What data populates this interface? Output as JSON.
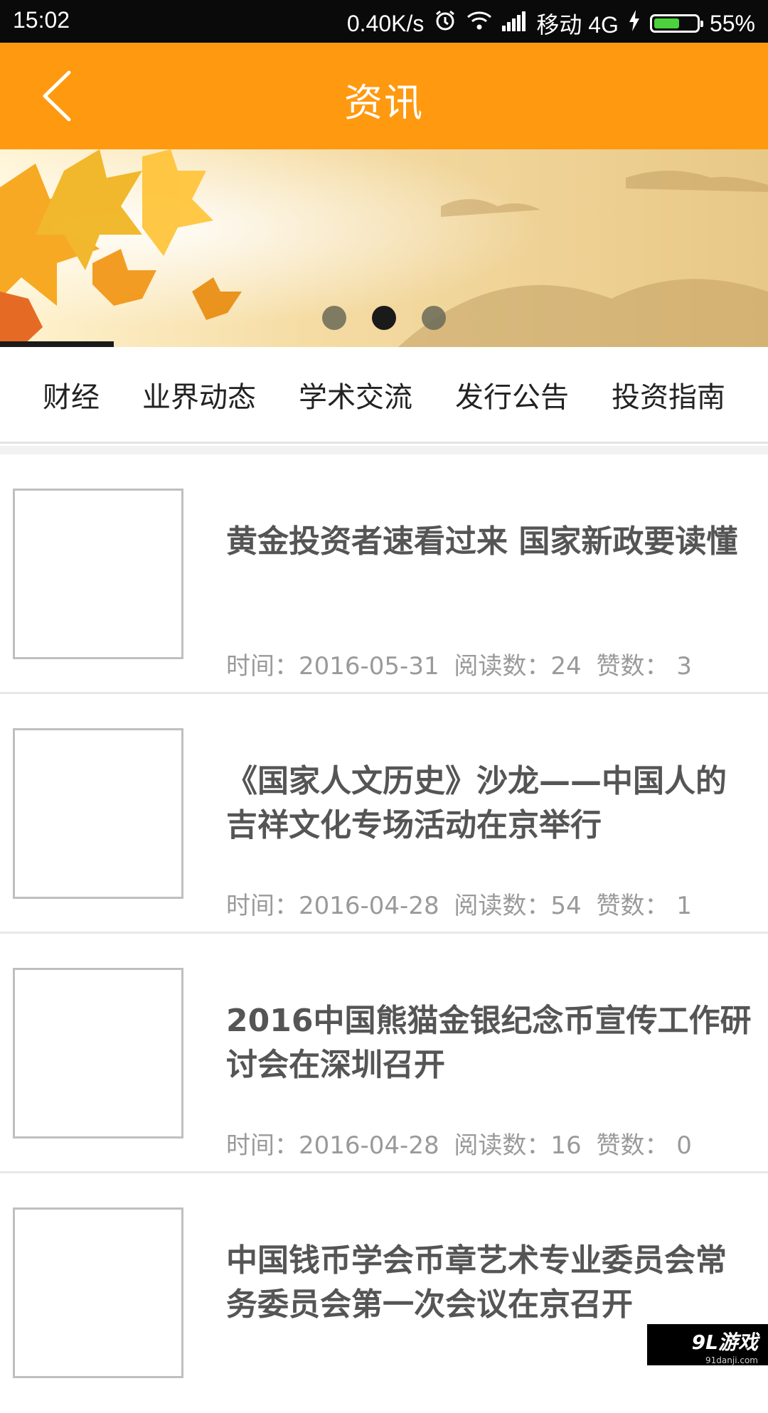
{
  "status_bar": {
    "time": "15:02",
    "speed": "0.40K/s",
    "carrier": "移动 4G",
    "battery": "55%"
  },
  "header": {
    "title": "资讯"
  },
  "banner": {
    "slides": 3,
    "active_slide_index": 1
  },
  "tabs": [
    "财经",
    "业界动态",
    "学术交流",
    "发行公告",
    "投资指南"
  ],
  "news": [
    {
      "title": "黄金投资者速看过来 国家新政要读懂",
      "time": "时间：2016-05-31",
      "reads": "阅读数：24",
      "likes": "赞数： 3"
    },
    {
      "title": "《国家人文历史》沙龙——中国人的吉祥文化专场活动在京举行",
      "time": "时间：2016-04-28",
      "reads": "阅读数：54",
      "likes": "赞数： 1"
    },
    {
      "title": "2016中国熊猫金银纪念币宣传工作研讨会在深圳召开",
      "time": "时间：2016-04-28",
      "reads": "阅读数：16",
      "likes": "赞数： 0"
    },
    {
      "title": "中国钱币学会币章艺术专业委员会常务委员会第一次会议在京召开",
      "time": "",
      "reads": "",
      "likes": ""
    }
  ],
  "watermark": {
    "main": "9L游戏",
    "sub": "91danji.com"
  },
  "colors": {
    "header": "#ff9910",
    "status_bar": "#0a0a0a",
    "battery_fill": "#4cd23c"
  }
}
